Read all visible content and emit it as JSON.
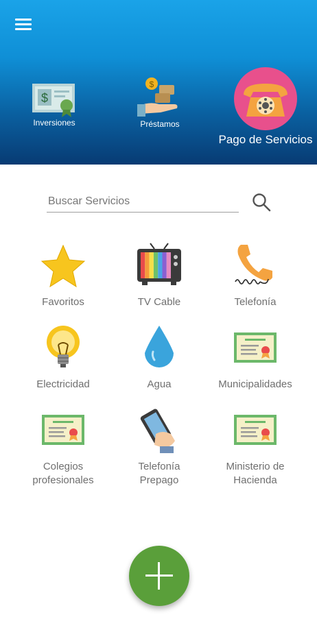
{
  "header": {
    "menu_icon": "hamburger-menu-icon",
    "tabs": [
      {
        "label": "Inversiones",
        "icon": "certificate-money-icon"
      },
      {
        "label": "Préstamos",
        "icon": "hand-money-icon"
      },
      {
        "label": "Pago de Servicios",
        "icon": "telephone-icon"
      }
    ]
  },
  "search": {
    "placeholder": "Buscar Servicios",
    "icon": "search-icon"
  },
  "services": [
    {
      "label": "Favoritos",
      "icon": "star-icon"
    },
    {
      "label": "TV Cable",
      "icon": "tv-icon"
    },
    {
      "label": "Telefonía",
      "icon": "phone-handset-icon"
    },
    {
      "label": "Electricidad",
      "icon": "lightbulb-icon"
    },
    {
      "label": "Agua",
      "icon": "water-drop-icon"
    },
    {
      "label": "Municipalidades",
      "icon": "certificate-icon"
    },
    {
      "label": "Colegios profesionales",
      "label_line1": "Colegios",
      "label_line2": "profesionales",
      "icon": "certificate-icon"
    },
    {
      "label": "Telefonía Prepago",
      "label_line1": "Telefonía",
      "label_line2": "Prepago",
      "icon": "mobile-phone-icon"
    },
    {
      "label": "Ministerio de Hacienda",
      "label_line1": "Ministerio de",
      "label_line2": "Hacienda",
      "icon": "certificate-icon"
    }
  ],
  "fab": {
    "icon": "plus-icon"
  },
  "colors": {
    "header_top": "#1aa3e8",
    "header_bottom": "#083b73",
    "fab": "#5a9f3a",
    "label_text": "#6f6f6f"
  }
}
